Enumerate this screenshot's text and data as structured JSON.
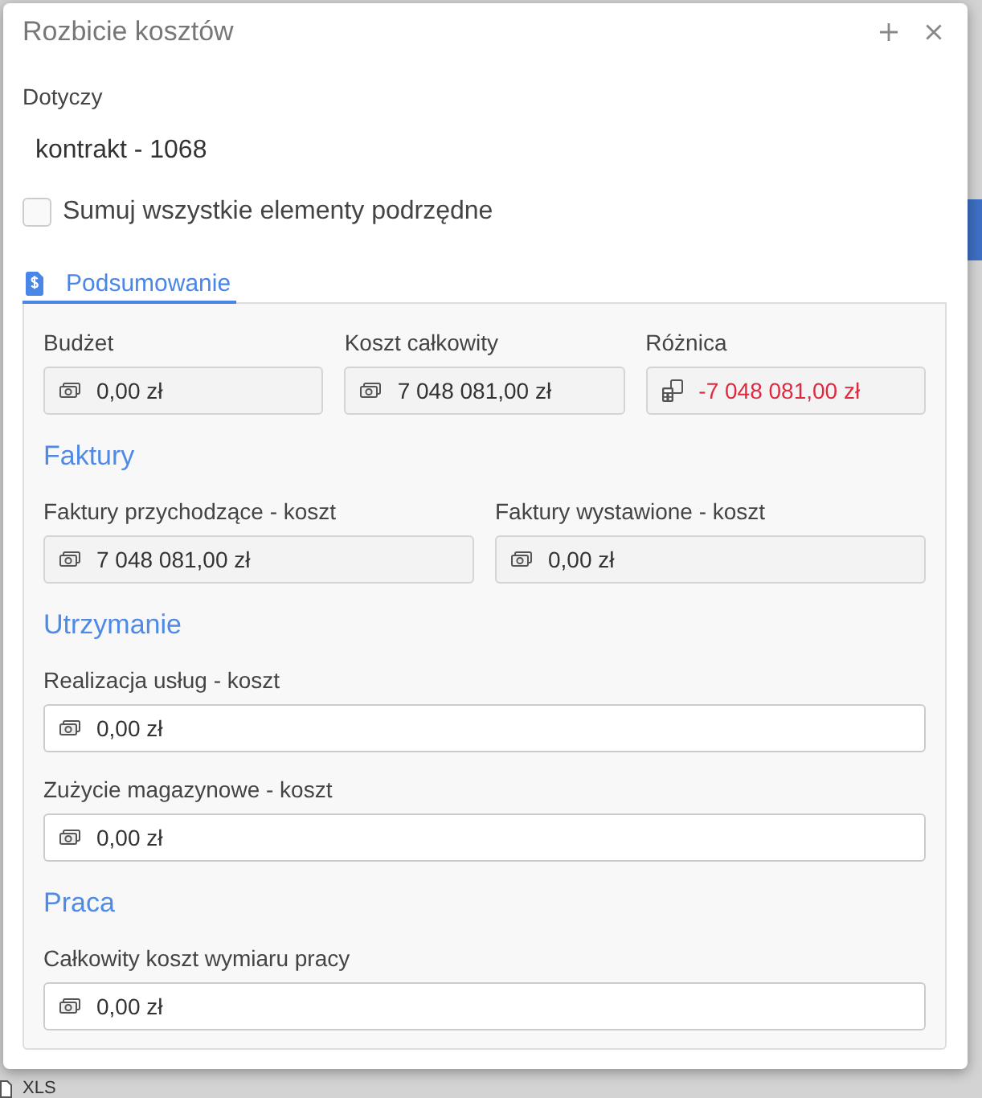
{
  "window": {
    "title": "Rozbicie kosztów"
  },
  "subject": {
    "label": "Dotyczy",
    "value": "kontrakt - 1068"
  },
  "option": {
    "label": "Sumuj wszystkie elementy podrzędne",
    "checked": false
  },
  "tabs": [
    {
      "label": "Podsumowanie",
      "selected": true
    }
  ],
  "tab_panel": {
    "groups": [
      {
        "rows": [
          [
            {
              "label": "Budżet",
              "value": "0,00 zł",
              "kind": "money",
              "disabled": true,
              "negative": false
            },
            {
              "label": "Koszt całkowity",
              "value": "7 048 081,00 zł",
              "kind": "money",
              "disabled": true,
              "negative": false
            },
            {
              "label": "Różnica",
              "value": "-7 048 081,00 zł",
              "kind": "calculator",
              "disabled": true,
              "negative": true
            }
          ]
        ]
      },
      {
        "title": "Faktury",
        "rows": [
          [
            {
              "label": "Faktury przychodzące - koszt",
              "value": "7 048 081,00 zł",
              "kind": "money",
              "disabled": true,
              "negative": false
            },
            {
              "label": "Faktury wystawione - koszt",
              "value": "0,00 zł",
              "kind": "money",
              "disabled": true,
              "negative": false
            }
          ]
        ]
      },
      {
        "title": "Utrzymanie",
        "rows": [
          [
            {
              "label": "Realizacja usług - koszt",
              "value": "0,00 zł",
              "kind": "money",
              "disabled": false,
              "negative": false
            }
          ],
          [
            {
              "label": "Zużycie magazynowe - koszt",
              "value": "0,00 zł",
              "kind": "money",
              "disabled": false,
              "negative": false
            }
          ]
        ]
      },
      {
        "title": "Praca",
        "rows": [
          [
            {
              "label": "Całkowity koszt wymiaru pracy",
              "value": "0,00 zł",
              "kind": "money",
              "disabled": false,
              "negative": false
            }
          ]
        ]
      }
    ]
  },
  "backdrop": {
    "file_label": "XLS"
  }
}
